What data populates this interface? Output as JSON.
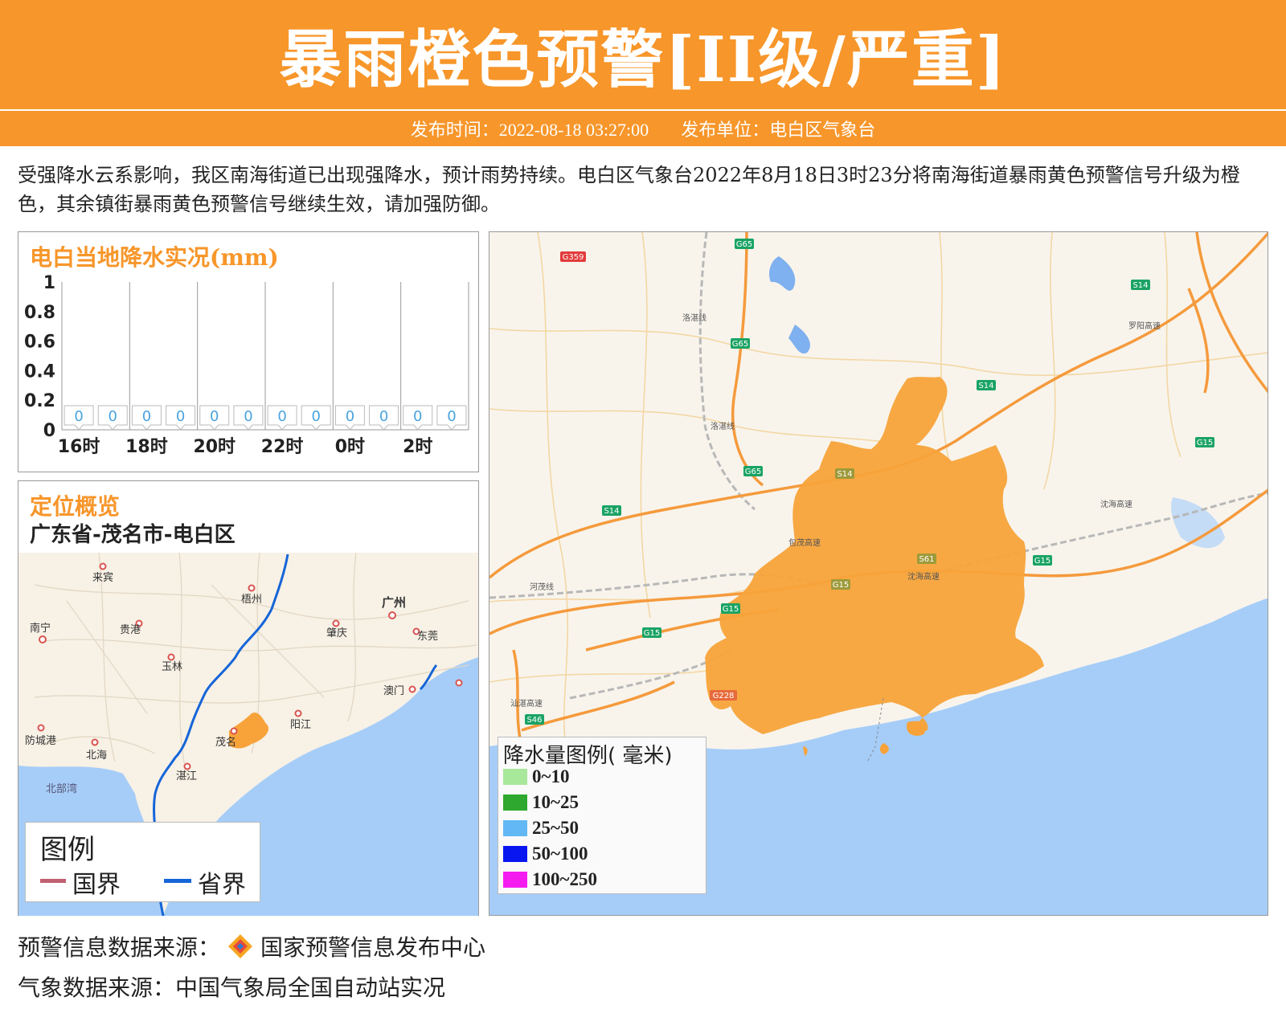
{
  "header": {
    "title": "暴雨橙色预警[II级/严重]",
    "issue_time_label": "发布时间：2022-08-18 03:27:00",
    "issuer_label": "发布单位：电白区气象台"
  },
  "description": "受强降水云系影响，我区南海街道已出现强降水，预计雨势持续。电白区气象台2022年8月18日3时23分将南海街道暴雨黄色预警信号升级为橙色，其余镇街暴雨黄色预警信号继续生效，请加强防御。",
  "rain_panel": {
    "title": "电白当地降水实况(mm)"
  },
  "chart_data": {
    "type": "line",
    "title": "电白当地降水实况(mm)",
    "ylim": [
      0,
      1
    ],
    "yticks": [
      "0",
      "0.2",
      "0.4",
      "0.6",
      "0.8",
      "1"
    ],
    "xticks": [
      "16时",
      "18时",
      "20时",
      "22时",
      "0时",
      "2时"
    ],
    "values": [
      0,
      0,
      0,
      0,
      0,
      0,
      0,
      0,
      0,
      0,
      0,
      0
    ],
    "data_labels": [
      "0",
      "0",
      "0",
      "0",
      "0",
      "0",
      "0",
      "0",
      "0",
      "0",
      "0",
      "0"
    ]
  },
  "location_panel": {
    "title": "定位概览",
    "region": "广东省-茂名市-电白区",
    "cities": [
      "来宾",
      "梧州",
      "广州",
      "南宁",
      "贵港",
      "肇庆",
      "东莞",
      "玉林",
      "澳门",
      "阳江",
      "防城港",
      "北海",
      "茂名",
      "湛江",
      "北部湾"
    ],
    "legend_title": "图例",
    "legend_items": [
      {
        "label": "国界",
        "color": "#c06070"
      },
      {
        "label": "省界",
        "color": "#1565d8"
      }
    ]
  },
  "main_map": {
    "road_labels": [
      "G65",
      "G359",
      "S14",
      "G65",
      "S14",
      "G65",
      "S14",
      "G15",
      "S14",
      "S61",
      "G15",
      "G15",
      "G15",
      "G15",
      "S46",
      "G228"
    ],
    "place_labels": [
      "洛湛线",
      "洛湛线",
      "包茂高速",
      "沈海高速",
      "沈海高速",
      "河茂线",
      "汕湛高速",
      "罗阳高速"
    ],
    "legend_title": "降水量图例( 毫米)",
    "legend_items": [
      {
        "label": "0~10",
        "color": "#a8e89a"
      },
      {
        "label": "10~25",
        "color": "#2ea82e"
      },
      {
        "label": "25~50",
        "color": "#62b8f5"
      },
      {
        "label": "50~100",
        "color": "#0a16f0"
      },
      {
        "label": "100~250",
        "color": "#f51cf0"
      }
    ],
    "warning_color": "#f7a33a"
  },
  "footer": {
    "warning_source": "预警信息数据来源：",
    "warning_source_name": "国家预警信息发布中心",
    "weather_source": "气象数据来源：中国气象局全国自动站实况"
  }
}
